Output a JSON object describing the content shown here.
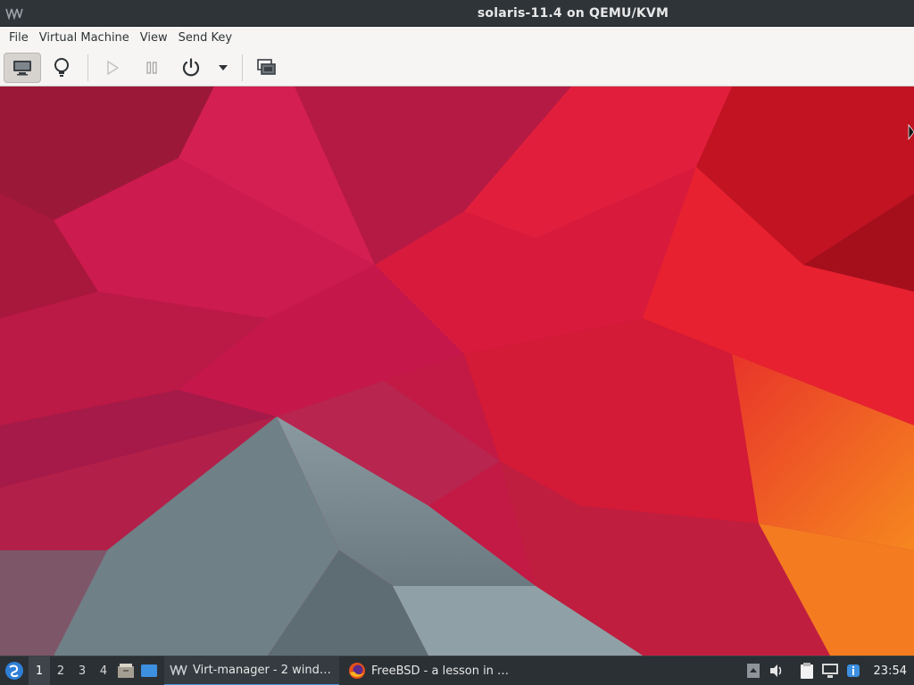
{
  "window": {
    "title": "solaris-11.4 on QEMU/KVM",
    "app_icon": "virt-manager-logo"
  },
  "menubar": {
    "items": [
      "File",
      "Virtual Machine",
      "View",
      "Send Key"
    ]
  },
  "toolbar": {
    "buttons": [
      {
        "icon": "monitor-icon",
        "active": true
      },
      {
        "icon": "lightbulb-icon",
        "active": false
      },
      {
        "icon": "play-icon",
        "active": false
      },
      {
        "icon": "pause-icon",
        "active": false
      },
      {
        "icon": "power-icon",
        "active": false
      },
      {
        "icon": "chevron-down-icon",
        "active": false
      },
      {
        "icon": "screenshot-icon",
        "active": false
      }
    ]
  },
  "taskbar": {
    "workspaces": [
      "1",
      "2",
      "3",
      "4"
    ],
    "active_workspace": "1",
    "tasks": [
      {
        "label": "Virt-manager - 2 wind…",
        "icon": "virt-manager-logo",
        "active": true
      },
      {
        "label": "FreeBSD - a lesson in …",
        "icon": "firefox-icon",
        "active": false
      }
    ],
    "clock": "23:54"
  },
  "colors": {
    "titlebar": "#2f3438",
    "taskbar": "#2b3034",
    "accent": "#4a90d9",
    "wallpaper_red": "#d01b3f",
    "wallpaper_orange": "#f06a1c",
    "wallpaper_gray": "#7a8c93"
  }
}
